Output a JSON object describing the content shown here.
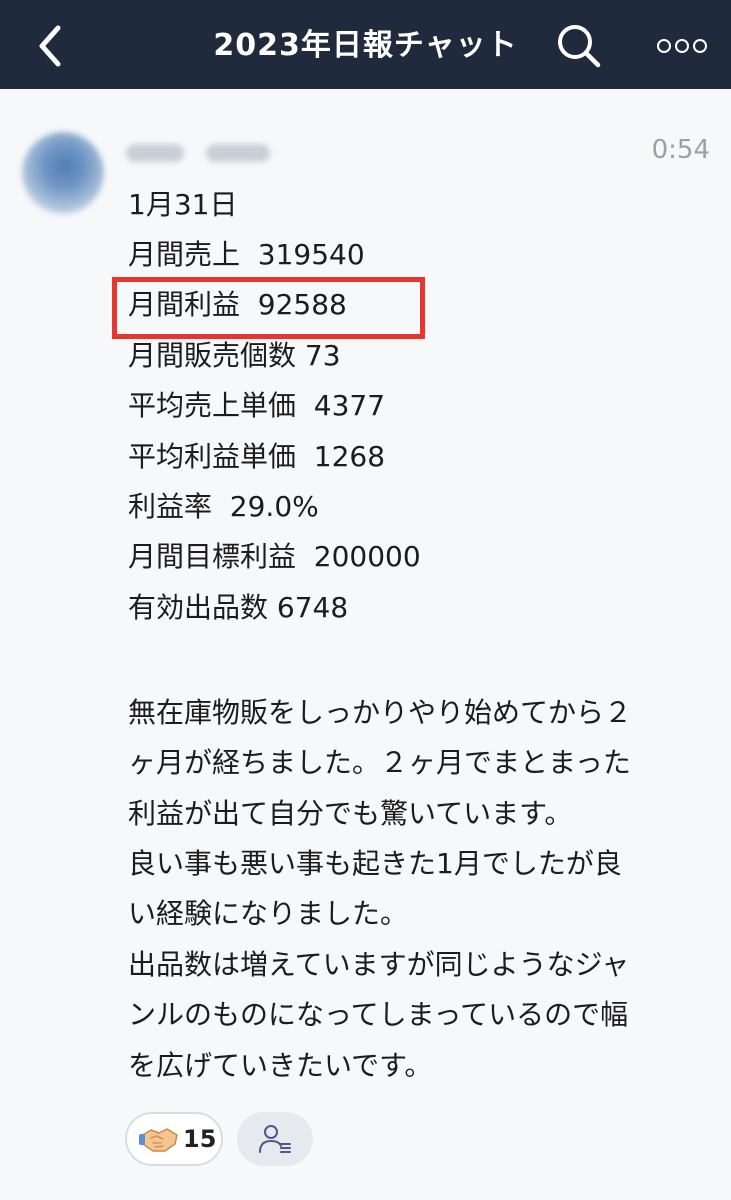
{
  "header": {
    "title": "2023年日報チャット",
    "back_icon": "chevron-left-icon",
    "search_icon": "search-icon",
    "more_icon": "more-options-icon",
    "background": "#1f2a3d"
  },
  "message": {
    "time": "0:54",
    "stats": [
      "1月31日",
      "月間売上  319540",
      "月間利益  92588",
      "月間販売個数 73",
      "平均売上単価  4377",
      "平均利益単価  1268",
      "利益率  29.0%",
      "月間目標利益  200000",
      "有効出品数 6748"
    ],
    "body": [
      "無在庫物販をしっかりやり始めてから２",
      "ヶ月が経ちました。２ヶ月でまとまった",
      "利益が出て自分でも驚いています。",
      "良い事も悪い事も起きた1月でしたが良",
      "い経験になりました。",
      "出品数は増えていますが同じようなジャ",
      "ンルのものになってしまっているので幅",
      "を広げていきたいです。"
    ],
    "highlight_color": "#e8352e"
  },
  "reactions": {
    "handshake_icon": "handshake-icon",
    "count": "15",
    "read_icon": "read-status-icon"
  }
}
